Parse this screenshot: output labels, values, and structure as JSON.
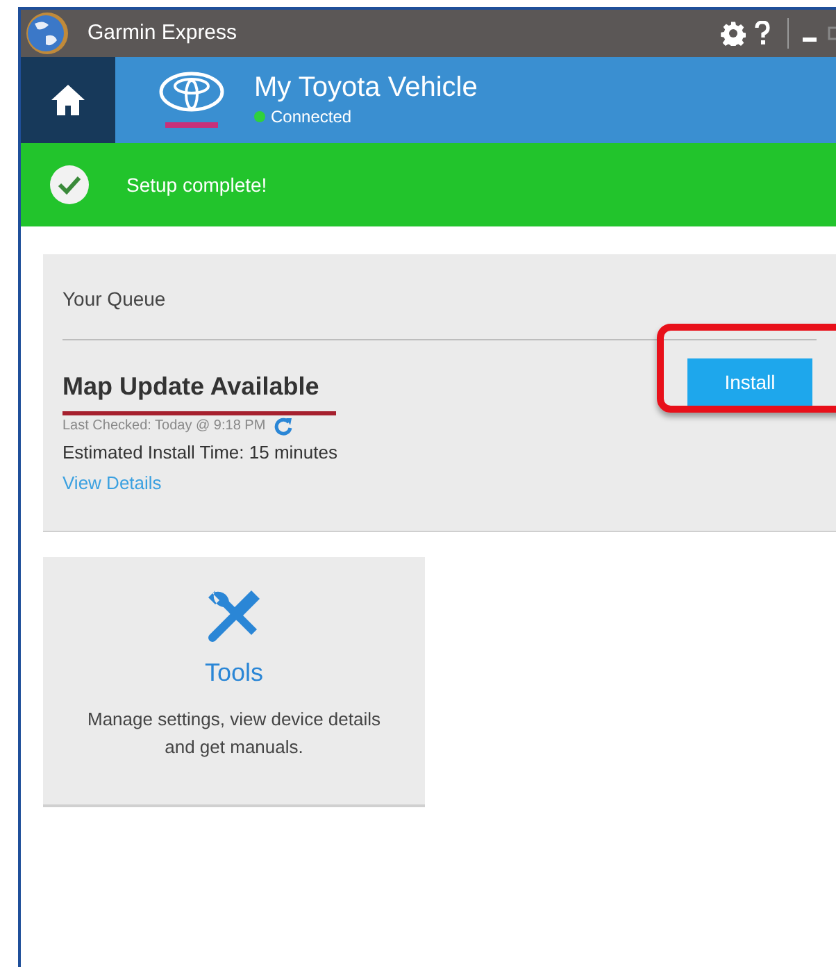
{
  "window": {
    "title": "Garmin Express"
  },
  "device": {
    "name": "My Toyota Vehicle",
    "status": "Connected",
    "connected": true
  },
  "banner": {
    "message": "Setup complete!"
  },
  "queue": {
    "title": "Your Queue",
    "item": {
      "title": "Map Update Available",
      "last_checked": "Last Checked: Today @ 9:18 PM",
      "estimate": "Estimated Install Time: 15 minutes",
      "link": "View Details",
      "button": "Install"
    }
  },
  "tiles": [
    {
      "title": "Tools",
      "description": "Manage settings, view device details and get manuals."
    }
  ]
}
